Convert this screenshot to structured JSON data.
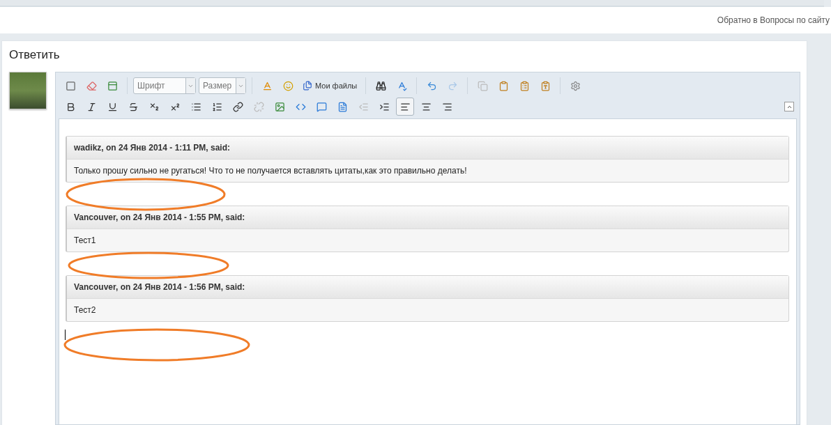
{
  "back_link": "Обратно в Вопросы по сайту",
  "reply_title": "Ответить",
  "toolbar": {
    "font_select": "Шрифт",
    "size_select": "Размер",
    "files_button": "Мои файлы"
  },
  "alignment_buttons": [
    {
      "selected": true
    },
    {
      "selected": false
    },
    {
      "selected": false
    }
  ],
  "quotes": [
    {
      "author": "wadikz",
      "on": ", on 24 Янв 2014 - ",
      "time": "1:11 PM",
      "said": ", said:",
      "body": "Только прошу сильно не ругаться! Что то не получается вставлять цитаты,как это правильно делать!"
    },
    {
      "author": "Vancouver",
      "on": ", on 24 Янв 2014 - ",
      "time": "1:55 PM",
      "said": ", said:",
      "body": "Тест1"
    },
    {
      "author": "Vancouver",
      "on": ", on 24 Янв 2014 - ",
      "time": "1:56 PM",
      "said": ", said:",
      "body": "Тест2"
    }
  ]
}
